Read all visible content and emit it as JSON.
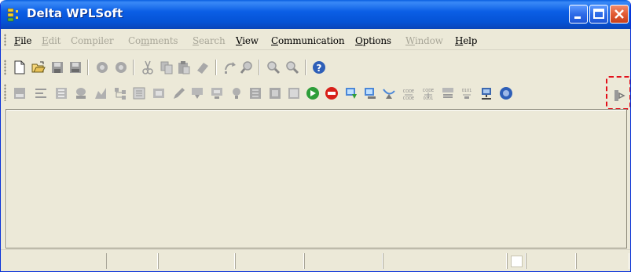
{
  "window": {
    "title": "Delta WPLSoft",
    "accent": "#0553D6"
  },
  "menubar": {
    "items": [
      {
        "label": "File",
        "ul": "F",
        "rest": "ile",
        "enabled": true
      },
      {
        "label": "Edit",
        "ul": "E",
        "rest": "dit",
        "enabled": false
      },
      {
        "label": "Compiler",
        "ul": "",
        "rest": "Compiler",
        "enabled": false
      },
      {
        "label": "Comments",
        "pre": "Co",
        "ul": "m",
        "rest": "ments",
        "enabled": false
      },
      {
        "label": "Search",
        "ul": "S",
        "rest": "earch",
        "enabled": false
      },
      {
        "label": "View",
        "ul": "V",
        "rest": "iew",
        "enabled": true
      },
      {
        "label": "Communication",
        "ul": "C",
        "rest": "ommunication",
        "enabled": true
      },
      {
        "label": "Options",
        "ul": "O",
        "rest": "ptions",
        "enabled": true
      },
      {
        "label": "Window",
        "ul": "W",
        "rest": "indow",
        "enabled": false
      },
      {
        "label": "Help",
        "ul": "H",
        "rest": "elp",
        "enabled": true
      }
    ]
  },
  "toolbar1": [
    "new-file-icon",
    "open-folder-icon",
    "save-icon",
    "save-all-icon",
    "undo-icon",
    "redo-icon",
    "cut-icon",
    "copy-icon",
    "paste-icon",
    "eraser-icon",
    "go-to-icon",
    "find-icon",
    "zoom-in-icon",
    "zoom-out-icon",
    "help-icon"
  ],
  "toolbar2": [
    "ladder-diagram-icon",
    "instruction-list-icon",
    "sfc-icon",
    "edit-mode-icon",
    "chart-icon",
    "tree-icon",
    "device-monitor-icon",
    "memory-icon",
    "pencil-icon",
    "write-plc-icon",
    "read-plc-icon",
    "bulb-icon",
    "register-icon",
    "register-edit-icon",
    "device-icon",
    "start-icon",
    "stop-icon",
    "download-icon",
    "upload-icon",
    "satellite-icon",
    "code-convert-icon",
    "code-compile-icon",
    "code-list-icon",
    "binary-code-icon",
    "network-icon",
    "info-icon",
    "communication-setting-icon"
  ],
  "statusbar": {
    "panels": [
      "",
      "",
      "",
      "",
      "",
      "",
      "",
      ""
    ]
  },
  "highlight": {
    "target": "communication-setting-icon",
    "color": "#E3101A"
  }
}
